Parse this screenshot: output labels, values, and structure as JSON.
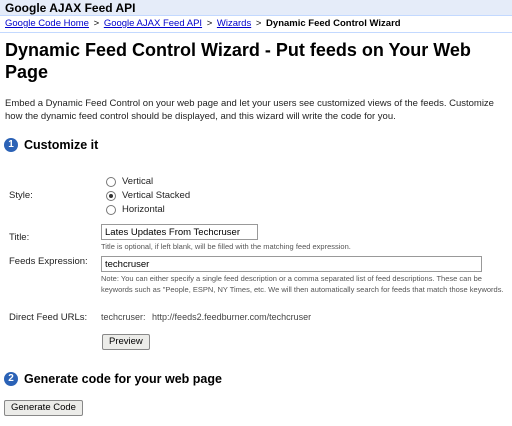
{
  "header": {
    "title": "Google AJAX Feed API"
  },
  "breadcrumb": {
    "items": [
      "Google Code Home",
      "Google AJAX Feed API",
      "Wizards"
    ],
    "separator": ">",
    "current": "Dynamic Feed Control Wizard"
  },
  "page": {
    "title": "Dynamic Feed Control Wizard - Put feeds on Your Web Page",
    "intro": "Embed a Dynamic Feed Control on your web page and let your users see customized views of the feeds. Customize how the dynamic feed control should be displayed, and this wizard will write the code for you."
  },
  "step1": {
    "number": "1",
    "heading": "Customize it",
    "style_label": "Style:",
    "style_options": [
      "Vertical",
      "Vertical Stacked",
      "Horizontal"
    ],
    "style_selected": "Vertical Stacked",
    "title_label": "Title:",
    "title_value": "Lates Updates From Techcruser",
    "title_hint": "Title is optional, if left blank, will be filled with the matching feed expression.",
    "feeds_label": "Feeds Expression:",
    "feeds_value": "techcruser",
    "feeds_hint": "Note: You can either specify a single feed description or a comma separated list of feed descriptions. These can be keywords such as \"People, ESPN, NY Times, etc. We will then automatically search for feeds that match those keywords.",
    "direct_label": "Direct Feed URLs:",
    "direct_name": "techcruser:",
    "direct_url": "http://feeds2.feedburner.com/techcruser",
    "preview_button": "Preview"
  },
  "step2": {
    "number": "2",
    "heading": "Generate code for your web page",
    "generate_button": "Generate Code"
  },
  "colors": {
    "header_bg": "#e5ecf9",
    "link": "#0000cc",
    "step_badge": "#2b62b6"
  }
}
